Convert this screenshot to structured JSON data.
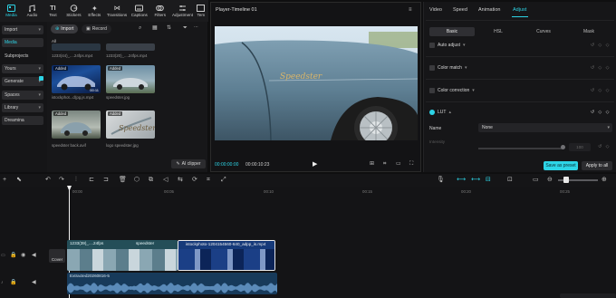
{
  "toolbar": {
    "items": [
      {
        "label": "Media",
        "icon": "media-icon"
      },
      {
        "label": "Audio",
        "icon": "audio-icon"
      },
      {
        "label": "Text",
        "icon": "text-icon"
      },
      {
        "label": "Stickers",
        "icon": "stickers-icon"
      },
      {
        "label": "Effects",
        "icon": "effects-icon"
      },
      {
        "label": "Transitions",
        "icon": "transitions-icon"
      },
      {
        "label": "Captions",
        "icon": "captions-icon"
      },
      {
        "label": "Filters",
        "icon": "filters-icon"
      },
      {
        "label": "Adjustment",
        "icon": "adjustment-icon"
      },
      {
        "label": "Tem",
        "icon": "templates-icon"
      }
    ]
  },
  "leftnav": {
    "items": [
      "Import",
      "Media",
      "Subprojects",
      "Yours",
      "Generate",
      "Spaces",
      "Library",
      "Dreamina"
    ]
  },
  "media": {
    "import_label": "Import",
    "record_label": "Record",
    "all_label": "All",
    "top_captions": [
      "1233(44)_....24fps.mp4",
      "1233(20)_....24fps.mp4"
    ],
    "items": [
      {
        "badge": "Added",
        "duration": "00:11",
        "caption": "istockphot...d(pg.js.mp4"
      },
      {
        "badge": "Added",
        "duration": "",
        "caption": "speedster.jpg"
      },
      {
        "badge": "Added",
        "duration": "",
        "caption": "speedster back.avif"
      },
      {
        "badge": "Added",
        "duration": "",
        "caption": "logo speedster.jpg"
      }
    ],
    "ai_clipper": "AI clipper"
  },
  "player": {
    "title": "Player-Timeline 01",
    "current_time": "00:00:00:00",
    "total_time": "00:00:10:23",
    "overlay_text": "Speedster"
  },
  "props": {
    "tabs": [
      "Video",
      "Speed",
      "Animation",
      "Adjust"
    ],
    "subtabs": [
      "Basic",
      "HSL",
      "Curves",
      "Mask"
    ],
    "sections": [
      "Auto adjust",
      "Color match",
      "Color correction",
      "LUT"
    ],
    "lut_name_label": "Name",
    "lut_name_value": "None",
    "intensity_label": "Intensity",
    "intensity_value": "100",
    "save_preset": "Save as preset",
    "apply_all": "Apply to all"
  },
  "timeline": {
    "ticks": [
      "00:00",
      "00:05",
      "00:10",
      "00:15",
      "00:20",
      "00:25",
      "00:30"
    ],
    "cover_label": "Cover",
    "clip1_label": "1233(39)_....24fps",
    "clip2_label": "istockphoto-1204154560-640_adpp_is.mp4",
    "clip3_label": "speedster",
    "audio_label": "Extracted20260816-5"
  },
  "colors": {
    "accent": "#2dd4e6",
    "panel": "#171719",
    "clip_border": "#e8e8e8"
  }
}
